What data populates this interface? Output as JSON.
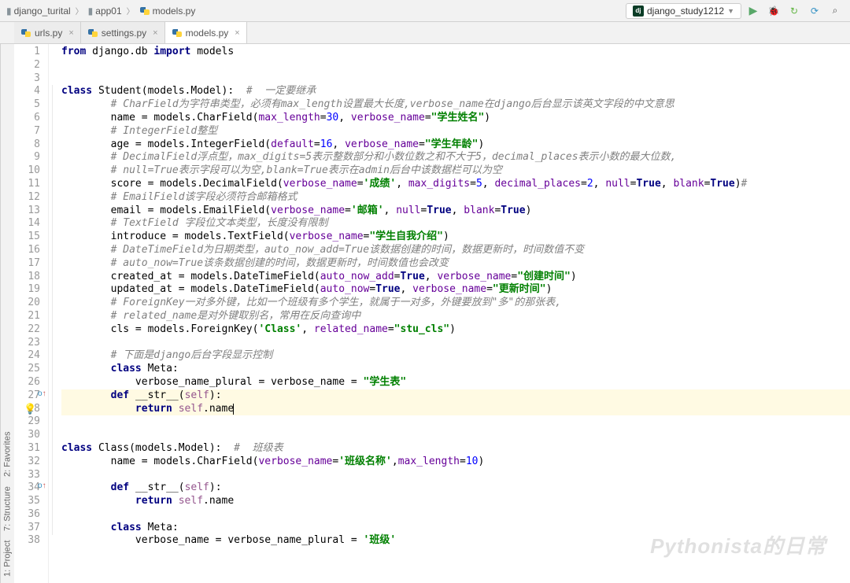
{
  "breadcrumb": [
    "django_turital",
    "app01",
    "models.py"
  ],
  "run_config": "django_study1212",
  "tabs": [
    {
      "name": "urls.py",
      "active": false
    },
    {
      "name": "settings.py",
      "active": false
    },
    {
      "name": "models.py",
      "active": true
    }
  ],
  "side_panels": [
    "1: Project",
    "7: Structure",
    "2: Favorites"
  ],
  "code": {
    "lines": [
      {
        "n": 1,
        "t": "import",
        "tokens": [
          [
            "kw",
            "from"
          ],
          [
            "op",
            " django.db "
          ],
          [
            "kw",
            "import"
          ],
          [
            "op",
            " models"
          ]
        ]
      },
      {
        "n": 2,
        "t": "blank"
      },
      {
        "n": 3,
        "t": "blank"
      },
      {
        "n": 4,
        "t": "class",
        "tokens": [
          [
            "kw",
            "class "
          ],
          [
            "cls",
            "Student"
          ],
          [
            "op",
            "(models.Model):  "
          ],
          [
            "cm",
            "#  一定要继承"
          ]
        ]
      },
      {
        "n": 5,
        "t": "comment",
        "indent": 2,
        "text": "# CharField为字符串类型，必须有max_length设置最大长度,verbose_name在django后台显示该英文字段的中文意思"
      },
      {
        "n": 6,
        "t": "stmt",
        "indent": 2,
        "tokens": [
          [
            "op",
            "name = models.CharField("
          ],
          [
            "param",
            "max_length"
          ],
          [
            "op",
            "="
          ],
          [
            "num",
            "30"
          ],
          [
            "op",
            ", "
          ],
          [
            "param",
            "verbose_name"
          ],
          [
            "op",
            "="
          ],
          [
            "str",
            "\"学生姓名\""
          ],
          [
            "op",
            ")"
          ]
        ]
      },
      {
        "n": 7,
        "t": "comment",
        "indent": 2,
        "text": "# IntegerField整型"
      },
      {
        "n": 8,
        "t": "stmt",
        "indent": 2,
        "tokens": [
          [
            "op",
            "age = models.IntegerField("
          ],
          [
            "param",
            "default"
          ],
          [
            "op",
            "="
          ],
          [
            "num",
            "16"
          ],
          [
            "op",
            ", "
          ],
          [
            "param",
            "verbose_name"
          ],
          [
            "op",
            "="
          ],
          [
            "str",
            "\"学生年龄\""
          ],
          [
            "op",
            ")"
          ]
        ]
      },
      {
        "n": 9,
        "t": "comment",
        "indent": 2,
        "text": "# DecimalField浮点型，max_digits=5表示整数部分和小数位数之和不大于5，decimal_places表示小数的最大位数,"
      },
      {
        "n": 10,
        "t": "comment",
        "indent": 2,
        "text": "# null=True表示字段可以为空,blank=True表示在admin后台中该数据栏可以为空"
      },
      {
        "n": 11,
        "t": "stmt",
        "indent": 2,
        "tokens": [
          [
            "op",
            "score = models.DecimalField("
          ],
          [
            "param",
            "verbose_name"
          ],
          [
            "op",
            "="
          ],
          [
            "str",
            "'成绩'"
          ],
          [
            "op",
            ", "
          ],
          [
            "param",
            "max_digits"
          ],
          [
            "op",
            "="
          ],
          [
            "num",
            "5"
          ],
          [
            "op",
            ", "
          ],
          [
            "param",
            "decimal_places"
          ],
          [
            "op",
            "="
          ],
          [
            "num",
            "2"
          ],
          [
            "op",
            ", "
          ],
          [
            "param",
            "null"
          ],
          [
            "op",
            "="
          ],
          [
            "kw",
            "True"
          ],
          [
            "op",
            ", "
          ],
          [
            "param",
            "blank"
          ],
          [
            "op",
            "="
          ],
          [
            "kw",
            "True"
          ],
          [
            "op",
            ")"
          ],
          [
            "cm",
            "#"
          ]
        ]
      },
      {
        "n": 12,
        "t": "comment",
        "indent": 2,
        "text": "# EmailField该字段必须符合邮箱格式"
      },
      {
        "n": 13,
        "t": "stmt",
        "indent": 2,
        "tokens": [
          [
            "op",
            "email = models.EmailField("
          ],
          [
            "param",
            "verbose_name"
          ],
          [
            "op",
            "="
          ],
          [
            "str",
            "'邮箱'"
          ],
          [
            "op",
            ", "
          ],
          [
            "param",
            "null"
          ],
          [
            "op",
            "="
          ],
          [
            "kw",
            "True"
          ],
          [
            "op",
            ", "
          ],
          [
            "param",
            "blank"
          ],
          [
            "op",
            "="
          ],
          [
            "kw",
            "True"
          ],
          [
            "op",
            ")"
          ]
        ]
      },
      {
        "n": 14,
        "t": "comment",
        "indent": 2,
        "text": "# TextField 字段位文本类型，长度没有限制"
      },
      {
        "n": 15,
        "t": "stmt",
        "indent": 2,
        "tokens": [
          [
            "op",
            "introduce = models.TextField("
          ],
          [
            "param",
            "verbose_name"
          ],
          [
            "op",
            "="
          ],
          [
            "str",
            "\"学生自我介绍\""
          ],
          [
            "op",
            ")"
          ]
        ]
      },
      {
        "n": 16,
        "t": "comment",
        "indent": 2,
        "text": "# DateTimeField为日期类型，auto_now_add=True该数据创建的时间，数据更新时，时间数值不变"
      },
      {
        "n": 17,
        "t": "comment",
        "indent": 2,
        "text": "# auto_now=True该条数据创建的时间，数据更新时，时间数值也会改变"
      },
      {
        "n": 18,
        "t": "stmt",
        "indent": 2,
        "tokens": [
          [
            "op",
            "created_at = models.DateTimeField("
          ],
          [
            "param",
            "auto_now_add"
          ],
          [
            "op",
            "="
          ],
          [
            "kw",
            "True"
          ],
          [
            "op",
            ", "
          ],
          [
            "param",
            "verbose_name"
          ],
          [
            "op",
            "="
          ],
          [
            "str",
            "\"创建时间\""
          ],
          [
            "op",
            ")"
          ]
        ]
      },
      {
        "n": 19,
        "t": "stmt",
        "indent": 2,
        "tokens": [
          [
            "op",
            "updated_at = models.DateTimeField("
          ],
          [
            "param",
            "auto_now"
          ],
          [
            "op",
            "="
          ],
          [
            "kw",
            "True"
          ],
          [
            "op",
            ", "
          ],
          [
            "param",
            "verbose_name"
          ],
          [
            "op",
            "="
          ],
          [
            "str",
            "\"更新时间\""
          ],
          [
            "op",
            ")"
          ]
        ]
      },
      {
        "n": 20,
        "t": "comment",
        "indent": 2,
        "text": "# ForeignKey一对多外键，比如一个班级有多个学生，就属于一对多，外键要放到\"多\"的那张表,"
      },
      {
        "n": 21,
        "t": "comment",
        "indent": 2,
        "text": "# related_name是对外键取别名，常用在反向查询中"
      },
      {
        "n": 22,
        "t": "stmt",
        "indent": 2,
        "tokens": [
          [
            "op",
            "cls = models.ForeignKey("
          ],
          [
            "str",
            "'Class'"
          ],
          [
            "op",
            ", "
          ],
          [
            "param",
            "related_name"
          ],
          [
            "op",
            "="
          ],
          [
            "str",
            "\"stu_cls\""
          ],
          [
            "op",
            ")"
          ]
        ]
      },
      {
        "n": 23,
        "t": "blank"
      },
      {
        "n": 24,
        "t": "comment",
        "indent": 2,
        "text": "# 下面是django后台字段显示控制"
      },
      {
        "n": 25,
        "t": "stmt",
        "indent": 2,
        "tokens": [
          [
            "kw",
            "class "
          ],
          [
            "cls",
            "Meta"
          ],
          [
            "op",
            ":"
          ]
        ]
      },
      {
        "n": 26,
        "t": "stmt",
        "indent": 3,
        "tokens": [
          [
            "op",
            "verbose_name_plural = verbose_name = "
          ],
          [
            "str",
            "\"学生表\""
          ]
        ]
      },
      {
        "n": 27,
        "t": "stmt",
        "indent": 2,
        "hl": true,
        "gutter": "override",
        "tokens": [
          [
            "kw",
            "def "
          ],
          [
            "fn",
            "__str__"
          ],
          [
            "op",
            "("
          ],
          [
            "self",
            "self"
          ],
          [
            "op",
            "):"
          ]
        ]
      },
      {
        "n": 28,
        "t": "stmt",
        "indent": 3,
        "hl": true,
        "bulb": true,
        "tokens": [
          [
            "kw",
            "return "
          ],
          [
            "self",
            "self"
          ],
          [
            "op",
            ".name"
          ]
        ],
        "cursor": true
      },
      {
        "n": 29,
        "t": "blank"
      },
      {
        "n": 30,
        "t": "blank"
      },
      {
        "n": 31,
        "t": "class",
        "tokens": [
          [
            "kw",
            "class "
          ],
          [
            "cls",
            "Class"
          ],
          [
            "op",
            "(models.Model):  "
          ],
          [
            "cm",
            "#  班级表"
          ]
        ]
      },
      {
        "n": 32,
        "t": "stmt",
        "indent": 2,
        "tokens": [
          [
            "op",
            "name = models.CharField("
          ],
          [
            "param",
            "verbose_name"
          ],
          [
            "op",
            "="
          ],
          [
            "str",
            "'班级名称'"
          ],
          [
            "op",
            ","
          ],
          [
            "param",
            "max_length"
          ],
          [
            "op",
            "="
          ],
          [
            "num",
            "10"
          ],
          [
            "op",
            ")"
          ]
        ]
      },
      {
        "n": 33,
        "t": "blank"
      },
      {
        "n": 34,
        "t": "stmt",
        "indent": 2,
        "gutter": "override",
        "tokens": [
          [
            "kw",
            "def "
          ],
          [
            "fn",
            "__str__"
          ],
          [
            "op",
            "("
          ],
          [
            "self",
            "self"
          ],
          [
            "op",
            "):"
          ]
        ]
      },
      {
        "n": 35,
        "t": "stmt",
        "indent": 3,
        "tokens": [
          [
            "kw",
            "return "
          ],
          [
            "self",
            "self"
          ],
          [
            "op",
            ".name"
          ]
        ]
      },
      {
        "n": 36,
        "t": "blank"
      },
      {
        "n": 37,
        "t": "stmt",
        "indent": 2,
        "tokens": [
          [
            "kw",
            "class "
          ],
          [
            "cls",
            "Meta"
          ],
          [
            "op",
            ":"
          ]
        ]
      },
      {
        "n": 38,
        "t": "stmt",
        "indent": 3,
        "tokens": [
          [
            "op",
            "verbose_name = verbose_name_plural = "
          ],
          [
            "str",
            "'班级'"
          ]
        ]
      }
    ]
  },
  "watermark": "Pythonista的日常"
}
